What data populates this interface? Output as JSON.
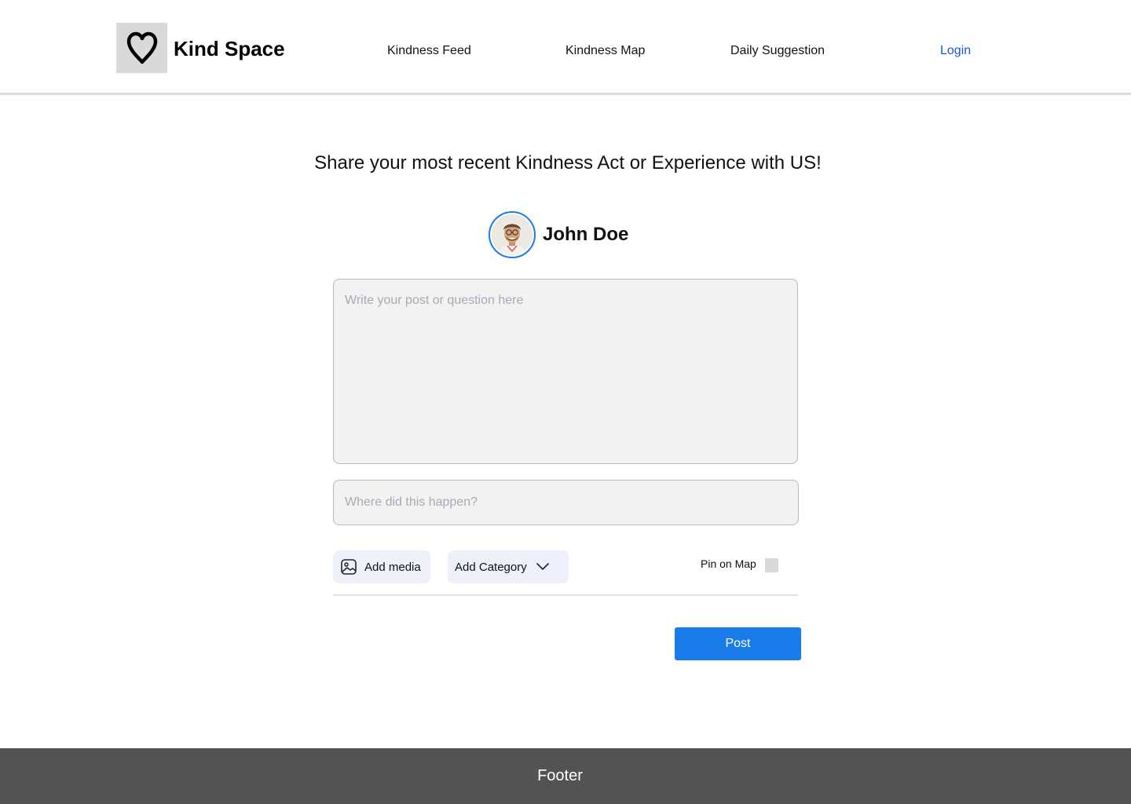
{
  "header": {
    "brand": "Kind Space",
    "logo_icon": "heart-icon",
    "nav": [
      {
        "label": "Kindness Feed"
      },
      {
        "label": "Kindness Map"
      },
      {
        "label": "Daily Suggestion"
      }
    ],
    "login_label": "Login",
    "login_color": "#1a56db"
  },
  "main": {
    "headline": "Share your most recent Kindness Act or Experience with US!",
    "user": {
      "name": "John Doe",
      "avatar_ring_color": "#1a7ce8"
    },
    "post_placeholder": "Write your post or question here",
    "location_placeholder": "Where did this happen?",
    "add_media_label": "Add media",
    "add_media_icon": "image-icon",
    "add_category_label": "Add Category",
    "add_category_icon": "chevron-down-icon",
    "pin_on_map_label": "Pin on Map",
    "post_button_label": "Post",
    "accent_color": "#1a7ce8"
  },
  "footer": {
    "label": "Footer",
    "background": "#545354"
  }
}
